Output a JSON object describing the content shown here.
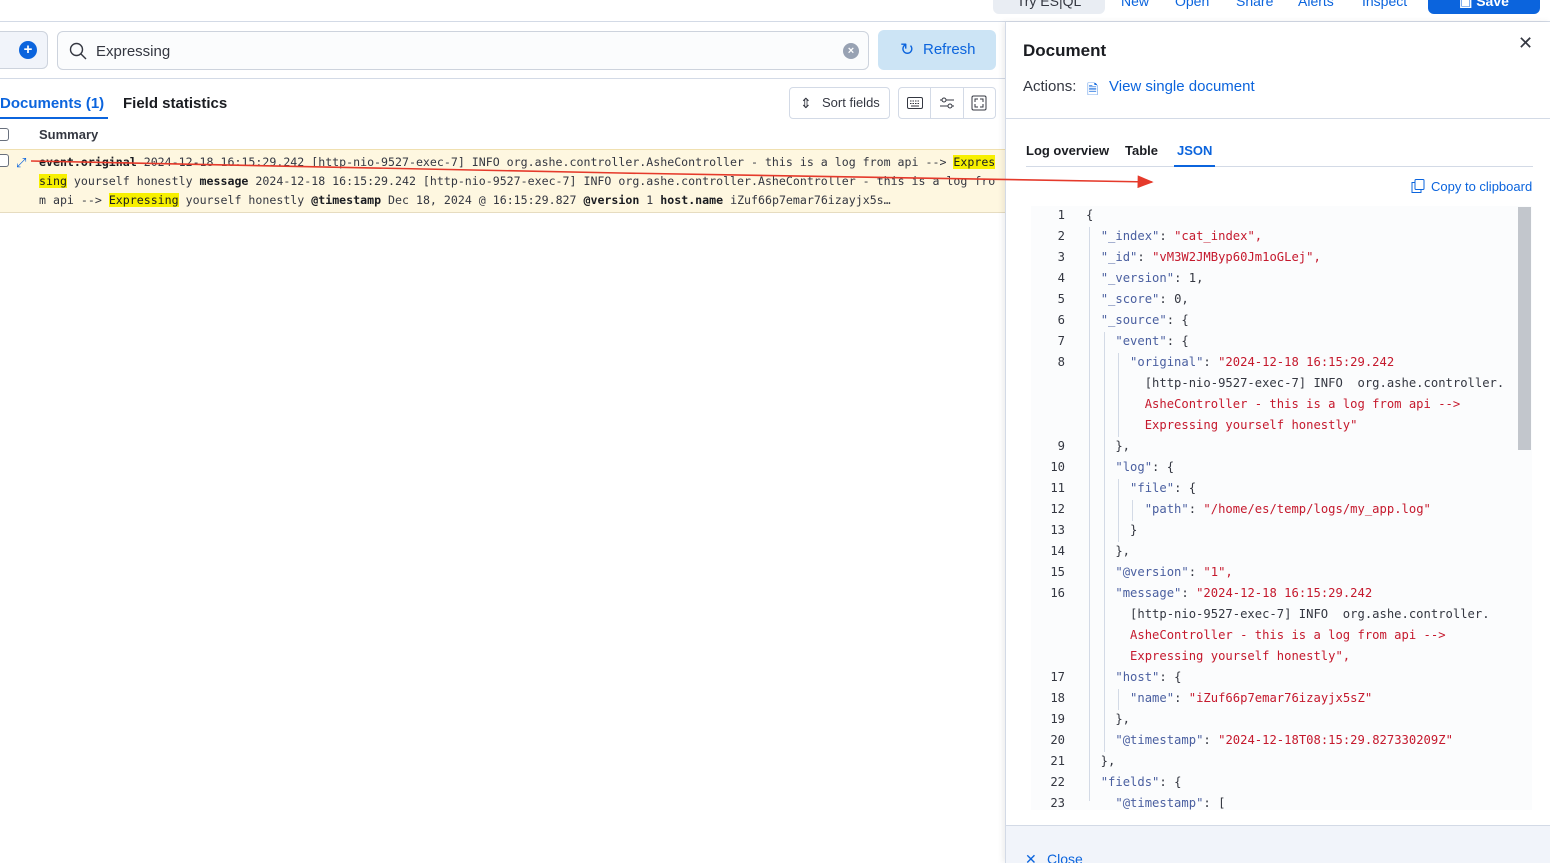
{
  "header": {
    "try_esql": "Try ES|QL",
    "links": [
      "New",
      "Open",
      "Share",
      "Alerts",
      "Inspect"
    ],
    "save": "Save"
  },
  "query": {
    "value": "Expressing",
    "refresh": "Refresh"
  },
  "documents": {
    "tab_docs": "Documents (1)",
    "tab_field_stats": "Field statistics",
    "sort_fields": "Sort fields",
    "summary_header": "Summary",
    "row": {
      "k1": "event.original",
      "v1a": "2024-12-18 16:15:29.242 [http-nio-9527-exec-7] INFO org.ashe.controller.AsheController - this is a log from api --> ",
      "h1": "Expressing",
      "v1b": " yourself honestly ",
      "k2": "message",
      "v2a": " 2024-12-18 16:15:29.242 [http-nio-9527-exec-7] INFO org.ashe.controller.AsheController - this is a log from api --> ",
      "h2": "Expressing",
      "v2b": " yourself honestly ",
      "k3": "@timestamp",
      "v3": " Dec 18, 2024 @ 16:15:29.827 ",
      "k4": "@version",
      "v4": " 1 ",
      "k5": "host.name",
      "v5": " iZuf66p7emar76izayjx5s…"
    }
  },
  "flyout": {
    "title": "Document",
    "actions_label": "Actions:",
    "view_single": "View single document",
    "tabs": [
      "Log overview",
      "Table",
      "JSON"
    ],
    "active_tab": "JSON",
    "copy": "Copy to clipboard",
    "close": "Close",
    "json_lines": [
      {
        "n": "1",
        "t": "{"
      },
      {
        "n": "2",
        "t": "  \"_index\": \"cat_index\","
      },
      {
        "n": "3",
        "t": "  \"_id\": \"vM3W2JMByp60Jm1oGLej\","
      },
      {
        "n": "4",
        "t": "  \"_version\": 1,"
      },
      {
        "n": "5",
        "t": "  \"_score\": 0,"
      },
      {
        "n": "6",
        "t": "  \"_source\": {"
      },
      {
        "n": "7",
        "t": "    \"event\": {"
      },
      {
        "n": "8",
        "t": "      \"original\": \"2024-12-18 16:15:29.242"
      },
      {
        "n": "",
        "t": "        [http-nio-9527-exec-7] INFO  org.ashe.controller."
      },
      {
        "n": "",
        "t": "        AsheController - this is a log from api -->"
      },
      {
        "n": "",
        "t": "        Expressing yourself honestly\""
      },
      {
        "n": "9",
        "t": "    },"
      },
      {
        "n": "10",
        "t": "    \"log\": {"
      },
      {
        "n": "11",
        "t": "      \"file\": {"
      },
      {
        "n": "12",
        "t": "        \"path\": \"/home/es/temp/logs/my_app.log\""
      },
      {
        "n": "13",
        "t": "      }"
      },
      {
        "n": "14",
        "t": "    },"
      },
      {
        "n": "15",
        "t": "    \"@version\": \"1\","
      },
      {
        "n": "16",
        "t": "    \"message\": \"2024-12-18 16:15:29.242"
      },
      {
        "n": "",
        "t": "      [http-nio-9527-exec-7] INFO  org.ashe.controller."
      },
      {
        "n": "",
        "t": "      AsheController - this is a log from api -->"
      },
      {
        "n": "",
        "t": "      Expressing yourself honestly\","
      },
      {
        "n": "17",
        "t": "    \"host\": {"
      },
      {
        "n": "18",
        "t": "      \"name\": \"iZuf66p7emar76izayjx5sZ\""
      },
      {
        "n": "19",
        "t": "    },"
      },
      {
        "n": "20",
        "t": "    \"@timestamp\": \"2024-12-18T08:15:29.827330209Z\""
      },
      {
        "n": "21",
        "t": "  },"
      },
      {
        "n": "22",
        "t": "  \"fields\": {"
      },
      {
        "n": "23",
        "t": "    \"@timestamp\": ["
      }
    ]
  },
  "colors": {
    "accent": "#0b64dd",
    "highlight": "#f7f000",
    "row_bg": "#fef7e0",
    "json_string": "#c5192d",
    "annotation_arrow": "#e53a2b"
  },
  "icons": {
    "add_filter": "plus-circle-icon",
    "search": "search-icon",
    "clear": "clear-icon",
    "refresh": "refresh-icon",
    "sort": "sort-icon",
    "keyboard": "keyboard-icon",
    "density": "density-icon",
    "fullscreen": "fullscreen-icon",
    "expand_row": "expand-icon",
    "document": "document-icon",
    "copy": "copy-icon",
    "close": "close-icon"
  }
}
